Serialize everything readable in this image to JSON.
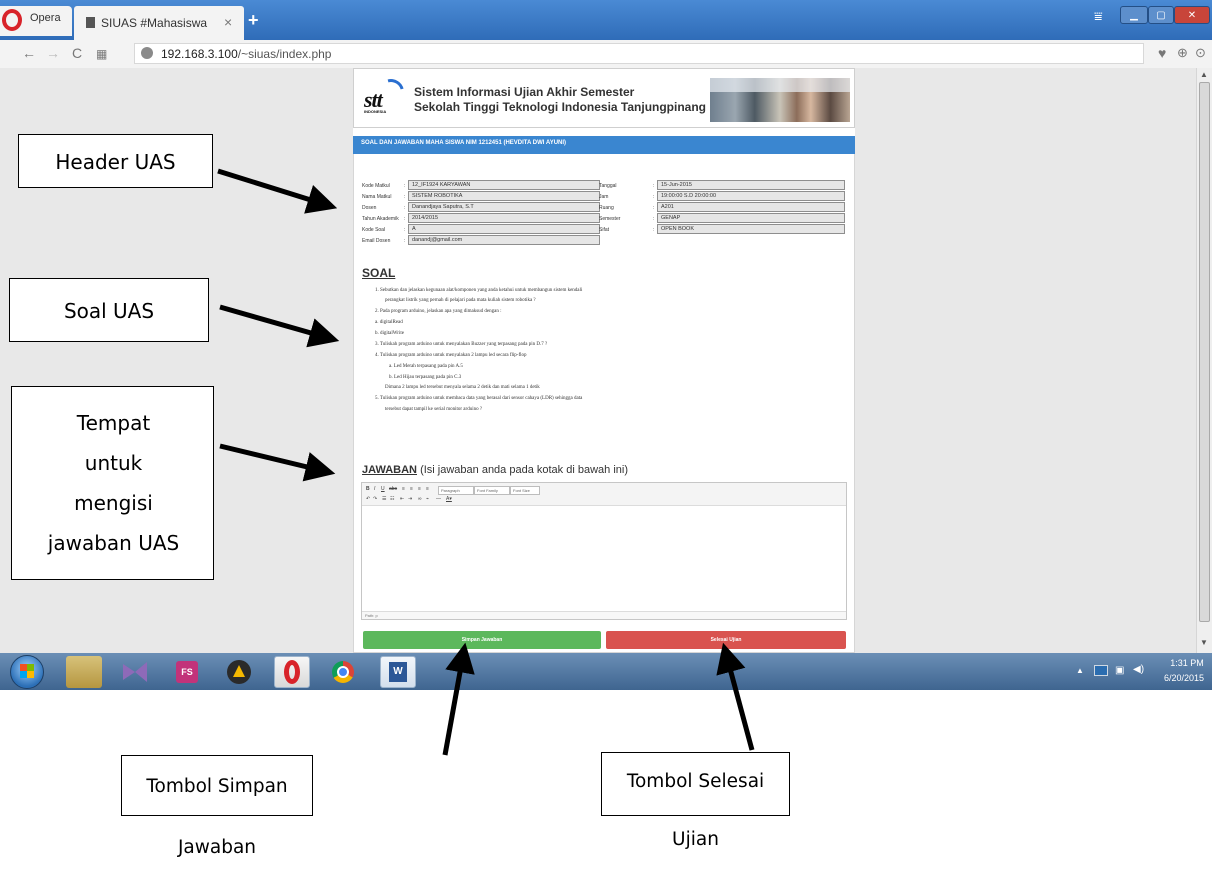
{
  "browser": {
    "menu_label": "Opera",
    "tab_title": "SIUAS #Mahasiswa",
    "tab_close": "×",
    "new_tab": "+",
    "url_host": "192.168.3.100",
    "url_path": "/~siuas/index.php",
    "icons": [
      "back-icon",
      "forward-icon",
      "reload-icon",
      "speed-dial-icon",
      "heart-icon",
      "download-icon",
      "account-icon"
    ]
  },
  "site": {
    "logo_text": "stt",
    "logo_sub": "INDONESIA",
    "title_line1": "Sistem Informasi Ujian Akhir Semester",
    "title_line2": "Sekolah Tinggi Teknologi Indonesia Tanjungpinang"
  },
  "panel": {
    "title": "SOAL DAN JAWABAN MAHA SISWA NIM 1212451 (HEVDITA DWI AYUNI)"
  },
  "info_left": [
    {
      "label": "Kode Matkul",
      "value": "12_IF1924 KARYAWAN"
    },
    {
      "label": "Nama Matkul",
      "value": "SISTEM ROBOTIKA"
    },
    {
      "label": "Dosen",
      "value": "Danandjaya Saputra, S.T"
    },
    {
      "label": "Tahun Akademik",
      "value": "2014/2015"
    },
    {
      "label": "Kode Soal",
      "value": "A"
    },
    {
      "label": "Email Dosen",
      "value": "danandj@gmail.com"
    }
  ],
  "info_right": [
    {
      "label": "Tanggal",
      "value": "15-Jun-2015"
    },
    {
      "label": "Jam",
      "value": "19:00:00 S.D 20:00:00"
    },
    {
      "label": "Ruang",
      "value": "A201"
    },
    {
      "label": "Semester",
      "value": "GENAP"
    },
    {
      "label": "Sifat",
      "value": "OPEN BOOK"
    }
  ],
  "soal": {
    "heading": "SOAL",
    "lines": [
      "1.  Sebutkan dan jelaskan kegunaan alat/komponen yang anda ketahui untuk membangun sistem kendali",
      "perangkat listrik yang pernah di pelajari pada mata kuliah sistem robotika ?",
      "2.  Pada program arduino, jelaskan apa yang dimaksud dengan :",
      "a.  digitalRead",
      "b.  digitalWrite",
      "3.  Tuliskah program arduino untuk menyalakan Buzzer yang terpasang pada pin D.7 ?",
      "4.  Tuliskan program arduino untuk menyalakan 2 lampu led secara flip-flop",
      "a.  Led Merah terpasang pada pin A.5",
      "b.  Led Hijau terpasang pada pin C.3",
      "Dimana 2 lampu led tersebut menyala selama  2 detik dan mati selama 1 detik",
      "5.  Tuliskan program arduino untuk membaca data yang berasal dari sensor cahaya (LDR) sehingga data",
      "tersebut dapat tampil ke serial monitor arduino ?"
    ]
  },
  "jawaban": {
    "heading": "JAWABAN",
    "hint": " (Isi jawaban anda pada kotak di bawah ini)",
    "toolbar_format": "Paragraph",
    "toolbar_font_family": "Font Family",
    "toolbar_font_size": "Font Size",
    "status_path": "Path: p"
  },
  "buttons": {
    "simpan": "Simpan Jawaban",
    "selesai": "Selesai Ujian"
  },
  "taskbar": {
    "fs_label": "FS",
    "word_label": "W",
    "time": "1:31 PM",
    "date": "6/20/2015"
  },
  "annotations": {
    "header": "Header UAS",
    "soal": "Soal UAS",
    "tempat_lines": [
      "Tempat",
      "untuk",
      "mengisi",
      "jawaban UAS"
    ],
    "simpan": "Tombol Simpan Jawaban",
    "selesai": "Tombol Selesai Ujian"
  }
}
